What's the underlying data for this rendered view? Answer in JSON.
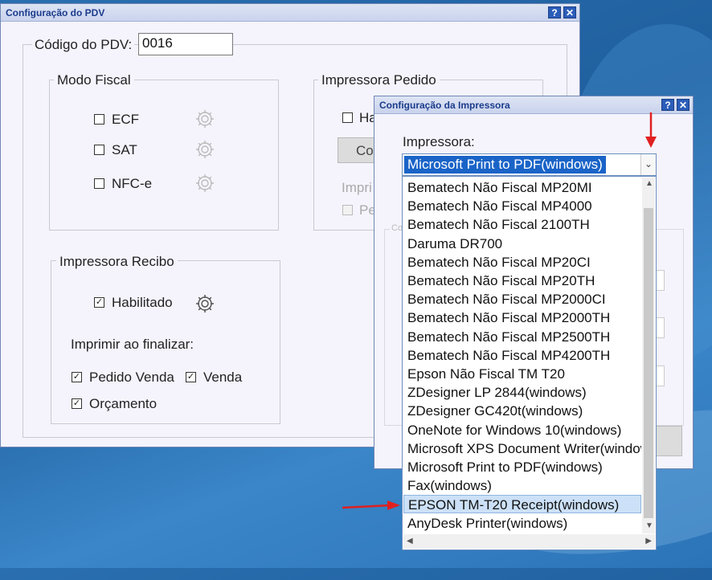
{
  "main_window": {
    "title": "Configuração do PDV",
    "help_icon": "?",
    "close_icon": "✕",
    "pdv_code_label": "Código do PDV:",
    "pdv_code_value": "0016",
    "modo_fiscal": {
      "title": "Modo Fiscal",
      "options": [
        {
          "label": "ECF",
          "checked": false
        },
        {
          "label": "SAT",
          "checked": false
        },
        {
          "label": "NFC-e",
          "checked": false
        }
      ]
    },
    "impressora_pedido": {
      "title": "Impressora Pedido",
      "habilitado_partial": "Ha",
      "config_button_partial": "Co",
      "imprimir_partial": "Impri",
      "pedido_partial": "Pe"
    },
    "impressora_recibo": {
      "title": "Impressora Recibo",
      "habilitado_label": "Habilitado",
      "habilitado_checked": true,
      "imprimir_label": "Imprimir ao finalizar:",
      "pedido_venda_label": "Pedido Venda",
      "venda_label": "Venda",
      "orcamento_label": "Orçamento"
    }
  },
  "dialog": {
    "title": "Configuração da Impressora",
    "help_icon": "?",
    "close_icon": "✕",
    "printer_label": "Impressora:",
    "selected_printer": "Microsoft Print to PDF(windows)",
    "ghost_group_partial": "Co",
    "printers": [
      "Bematech Não Fiscal MP20MI",
      "Bematech Não Fiscal MP4000",
      "Bematech Não Fiscal 2100TH",
      "Daruma DR700",
      "Bematech Não Fiscal MP20CI",
      "Bematech Não Fiscal MP20TH",
      "Bematech Não Fiscal MP2000CI",
      "Bematech Não Fiscal MP2000TH",
      "Bematech Não Fiscal MP2500TH",
      "Bematech Não Fiscal MP4200TH",
      "Epson Não Fiscal TM T20",
      "ZDesigner LP 2844(windows)",
      "ZDesigner GC420t(windows)",
      "OneNote for Windows 10(windows)",
      "Microsoft XPS Document Writer(windows)",
      "Microsoft Print to PDF(windows)",
      "Fax(windows)",
      "EPSON TM-T20 Receipt(windows)",
      "AnyDesk Printer(windows)"
    ],
    "highlighted_index": 17
  },
  "colors": {
    "selection_blue": "#1a64c8",
    "highlight_row": "#cce1f7",
    "annotation_red": "#e02020"
  },
  "icons": [
    "gear-icon",
    "help-icon",
    "close-icon",
    "chevron-down-icon",
    "arrow-up-icon",
    "arrow-down-icon",
    "arrow-left-icon",
    "arrow-right-icon",
    "red-annotation-arrow"
  ]
}
